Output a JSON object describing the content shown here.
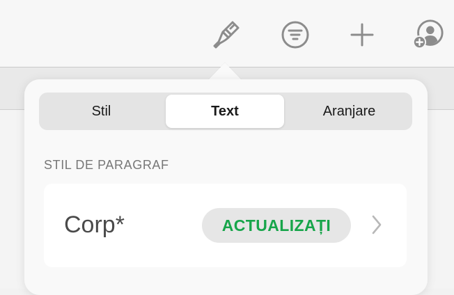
{
  "toolbar": {
    "icons": [
      "paintbrush-icon",
      "filter-icon",
      "plus-icon",
      "add-person-icon"
    ],
    "icon_color": "#8c8c8c"
  },
  "popover": {
    "tabs": [
      {
        "label": "Stil",
        "selected": false
      },
      {
        "label": "Text",
        "selected": true
      },
      {
        "label": "Aranjare",
        "selected": false
      }
    ],
    "section_title": "STIL DE PARAGRAF",
    "paragraph_style": {
      "name": "Corp*",
      "update_label": "ACTUALIZAȚI",
      "update_color": "#17a54a"
    }
  }
}
